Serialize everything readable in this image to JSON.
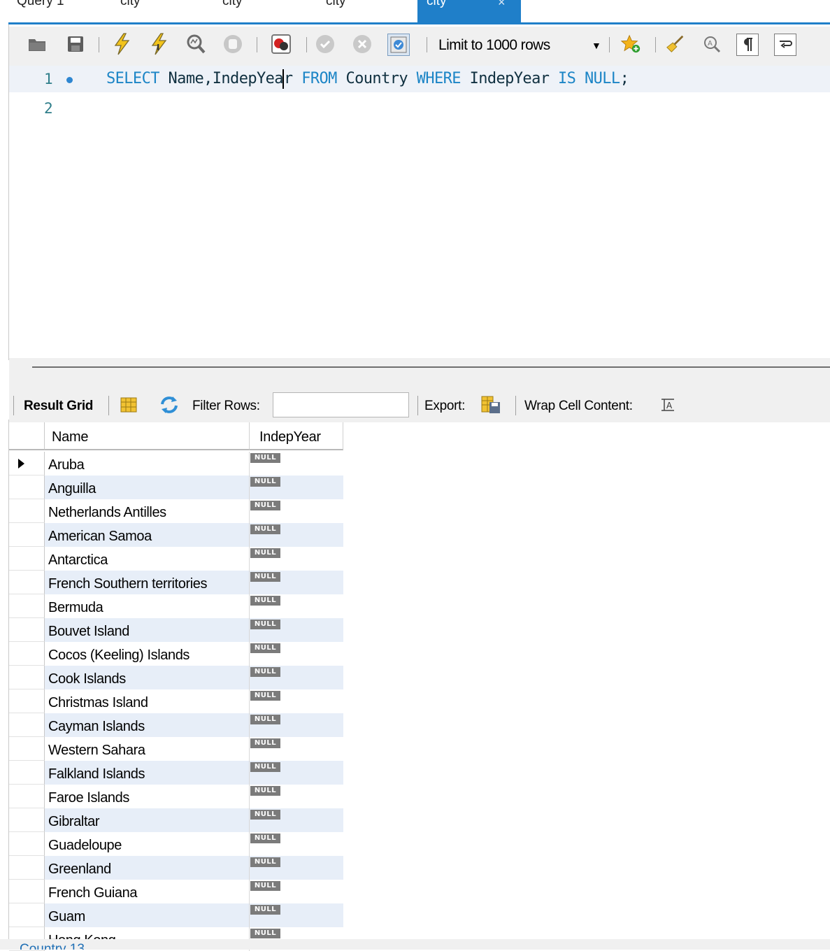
{
  "tabs": [
    {
      "label": "Query 1",
      "active": false
    },
    {
      "label": "city",
      "active": false
    },
    {
      "label": "city",
      "active": false
    },
    {
      "label": "city",
      "active": false
    },
    {
      "label": "city",
      "active": true,
      "close": "×"
    }
  ],
  "toolbar": {
    "limit_label": "Limit to 1000 rows",
    "icons": [
      "open-folder-icon",
      "save-icon",
      "execute-icon",
      "execute-current-icon",
      "explain-icon",
      "stop-icon",
      "toggle-error-icon",
      "commit-icon",
      "rollback-icon",
      "autocommit-icon",
      "dropdown-arrow-icon",
      "snippet-icon",
      "beautify-icon",
      "find-icon",
      "invisible-chars-icon",
      "wrap-icon"
    ]
  },
  "editor": {
    "lines": [
      {
        "number": "1",
        "code": "SELECT Name,IndepYear FROM Country WHERE IndepYear IS NULL;"
      },
      {
        "number": "2",
        "code": ""
      }
    ],
    "tokens": {
      "select": "SELECT",
      "cols_a": "Name,IndepYea",
      "cols_b": "r",
      "from": "FROM",
      "table": "Country",
      "where": "WHERE",
      "col": "IndepYear",
      "is": "IS",
      "null": "NULL",
      "semi": ";"
    }
  },
  "result_toolbar": {
    "result_grid": "Result Grid",
    "filter_label": "Filter Rows:",
    "filter_value": "",
    "export_label": "Export:",
    "wrap_label": "Wrap Cell Content:"
  },
  "grid": {
    "columns": [
      "Name",
      "IndepYear"
    ],
    "rows": [
      {
        "name": "Aruba",
        "year": "NULL"
      },
      {
        "name": "Anguilla",
        "year": "NULL"
      },
      {
        "name": "Netherlands Antilles",
        "year": "NULL"
      },
      {
        "name": "American Samoa",
        "year": "NULL"
      },
      {
        "name": "Antarctica",
        "year": "NULL"
      },
      {
        "name": "French Southern territories",
        "year": "NULL"
      },
      {
        "name": "Bermuda",
        "year": "NULL"
      },
      {
        "name": "Bouvet Island",
        "year": "NULL"
      },
      {
        "name": "Cocos (Keeling) Islands",
        "year": "NULL"
      },
      {
        "name": "Cook Islands",
        "year": "NULL"
      },
      {
        "name": "Christmas Island",
        "year": "NULL"
      },
      {
        "name": "Cayman Islands",
        "year": "NULL"
      },
      {
        "name": "Western Sahara",
        "year": "NULL"
      },
      {
        "name": "Falkland Islands",
        "year": "NULL"
      },
      {
        "name": "Faroe Islands",
        "year": "NULL"
      },
      {
        "name": "Gibraltar",
        "year": "NULL"
      },
      {
        "name": "Guadeloupe",
        "year": "NULL"
      },
      {
        "name": "Greenland",
        "year": "NULL"
      },
      {
        "name": "French Guiana",
        "year": "NULL"
      },
      {
        "name": "Guam",
        "year": "NULL"
      },
      {
        "name": "Hong Kong",
        "year": "NULL"
      }
    ]
  },
  "bottom_tab": {
    "label": "Country 13"
  },
  "colors": {
    "accent": "#1f7fc9",
    "keyword": "#1c85c6",
    "row_alt": "#e7eef8",
    "null_badge": "#7b7b7b"
  }
}
